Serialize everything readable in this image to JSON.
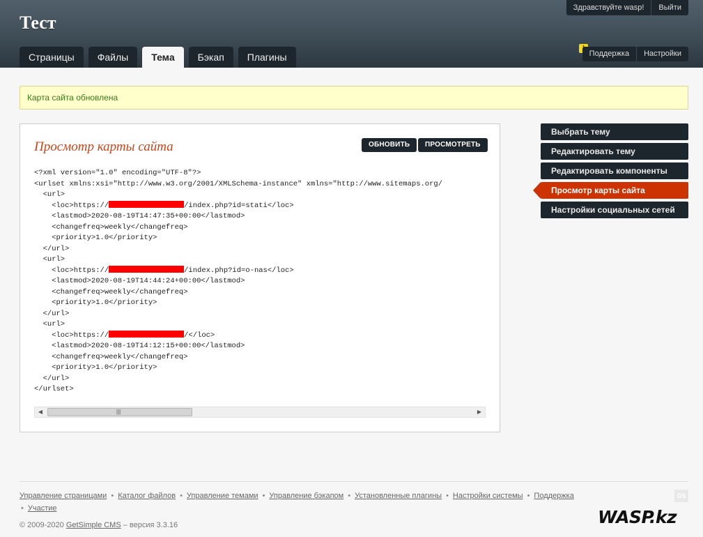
{
  "header": {
    "site_title": "Тест",
    "tabs": [
      "Страницы",
      "Файлы",
      "Тема",
      "Бэкап",
      "Плагины"
    ],
    "active_tab": "Тема",
    "user_greeting": "Здравствуйте wasp!",
    "logout_label": "Выйти",
    "support_label": "Поддержка",
    "settings_label": "Настройки",
    "warning_badge": "!"
  },
  "notice": {
    "text": "Карта сайта обновлена"
  },
  "main": {
    "title": "Просмотр карты сайта",
    "refresh_label": "ОБНОВИТЬ",
    "view_label": "ПРОСМОТРЕТЬ",
    "xml_lines": [
      "<?xml version=\"1.0\" encoding=\"UTF-8\"?>",
      "<urlset xmlns:xsi=\"http://www.w3.org/2001/XMLSchema-instance\" xmlns=\"http://www.sitemaps.org/",
      "  <url>",
      "    <loc>https://",
      "    <lastmod>2020-08-19T14:47:35+00:00</lastmod>",
      "    <changefreq>weekly</changefreq>",
      "    <priority>1.0</priority>",
      "  </url>",
      "  <url>",
      "    <loc>https://",
      "    <lastmod>2020-08-19T14:44:24+00:00</lastmod>",
      "    <changefreq>weekly</changefreq>",
      "    <priority>1.0</priority>",
      "  </url>",
      "  <url>",
      "    <loc>https://",
      "    <lastmod>2020-08-19T14:12:15+00:00</lastmod>",
      "    <changefreq>weekly</changefreq>",
      "    <priority>1.0</priority>",
      "  </url>",
      "</urlset>"
    ],
    "loc_suffixes": [
      "/index.php?id=stati</loc>",
      "/index.php?id=o-nas</loc>",
      "/</loc>"
    ],
    "scroll_grip": "|||"
  },
  "sidebar": {
    "items": [
      "Выбрать тему",
      "Редактировать тему",
      "Редактировать компоненты",
      "Просмотр карты сайта",
      "Настройки социальных сетей"
    ],
    "current_item": "Просмотр карты сайта"
  },
  "footer": {
    "links": [
      "Управление страницами",
      "Каталог файлов",
      "Управление темами",
      "Управление бэкапом",
      "Установленные плагины",
      "Настройки системы",
      "Поддержка",
      "Участие"
    ],
    "separator": "•",
    "copyright_prefix": "© 2009-2020",
    "copyright_link": "GetSimple CMS",
    "copyright_suffix": "– версия 3.3.16",
    "logo_text": "GS"
  },
  "watermark": "WASP.kz"
}
